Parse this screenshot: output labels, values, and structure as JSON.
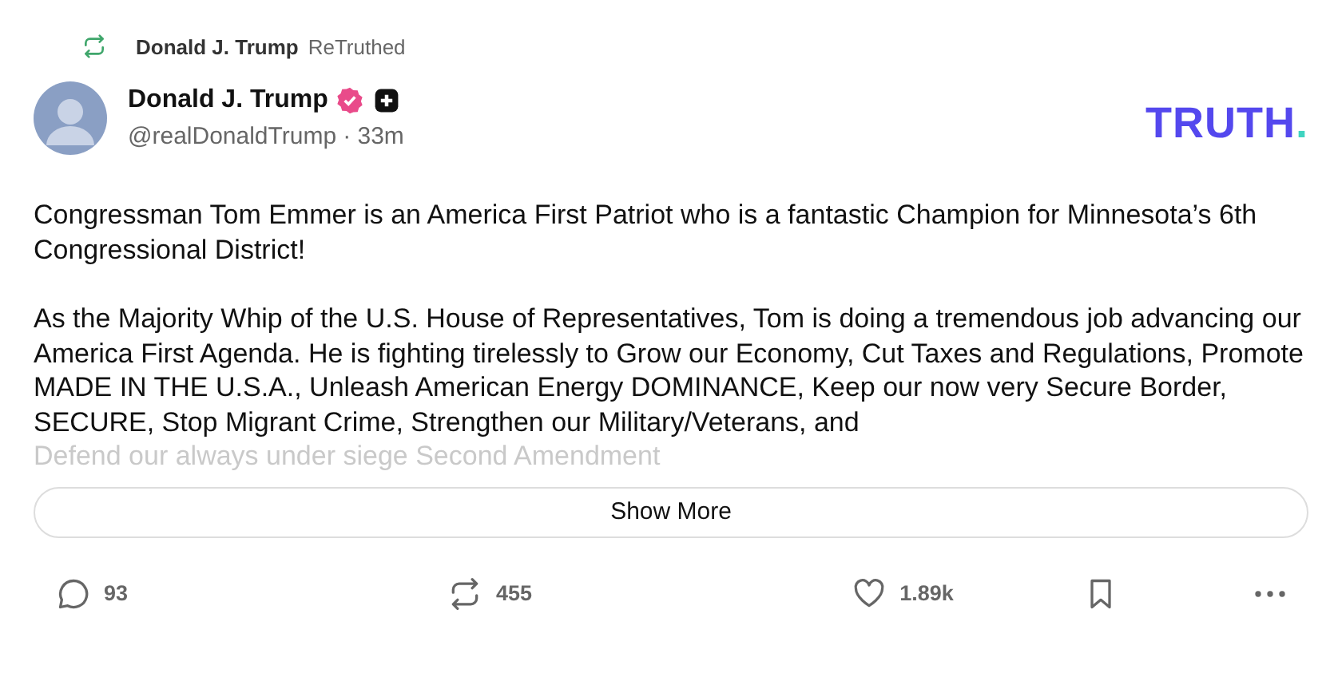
{
  "retruth": {
    "name": "Donald J. Trump",
    "label": "ReTruthed"
  },
  "author": {
    "name": "Donald J. Trump",
    "verified": true,
    "handle": "@realDonaldTrump",
    "time": "· 33m"
  },
  "logo": {
    "word": "TRUTH",
    "dot": "."
  },
  "post": {
    "paragraphs": [
      "Congressman Tom Emmer is an America First Patriot who is a fantastic Champion for Minnesota’s 6th Congressional District!",
      "As the Majority Whip of the U.S. House of Representatives, Tom is doing a tremendous job advancing our America First Agenda. He is fighting tirelessly to Grow our Economy, Cut Taxes and Regulations, Promote MADE IN THE U.S.A., Unleash American Energy DOMINANCE, Keep our now very Secure Border, SECURE, Stop Migrant Crime, Strengthen our Military/Veterans, and"
    ],
    "faded_line": "Defend our always under siege Second Amendment"
  },
  "show_more": "Show More",
  "actions": [
    {
      "kind": "reply",
      "count": "93"
    },
    {
      "kind": "retruth",
      "count": "455"
    },
    {
      "kind": "like",
      "count": "1.89k"
    },
    {
      "kind": "bookmark"
    },
    {
      "kind": "more"
    }
  ]
}
